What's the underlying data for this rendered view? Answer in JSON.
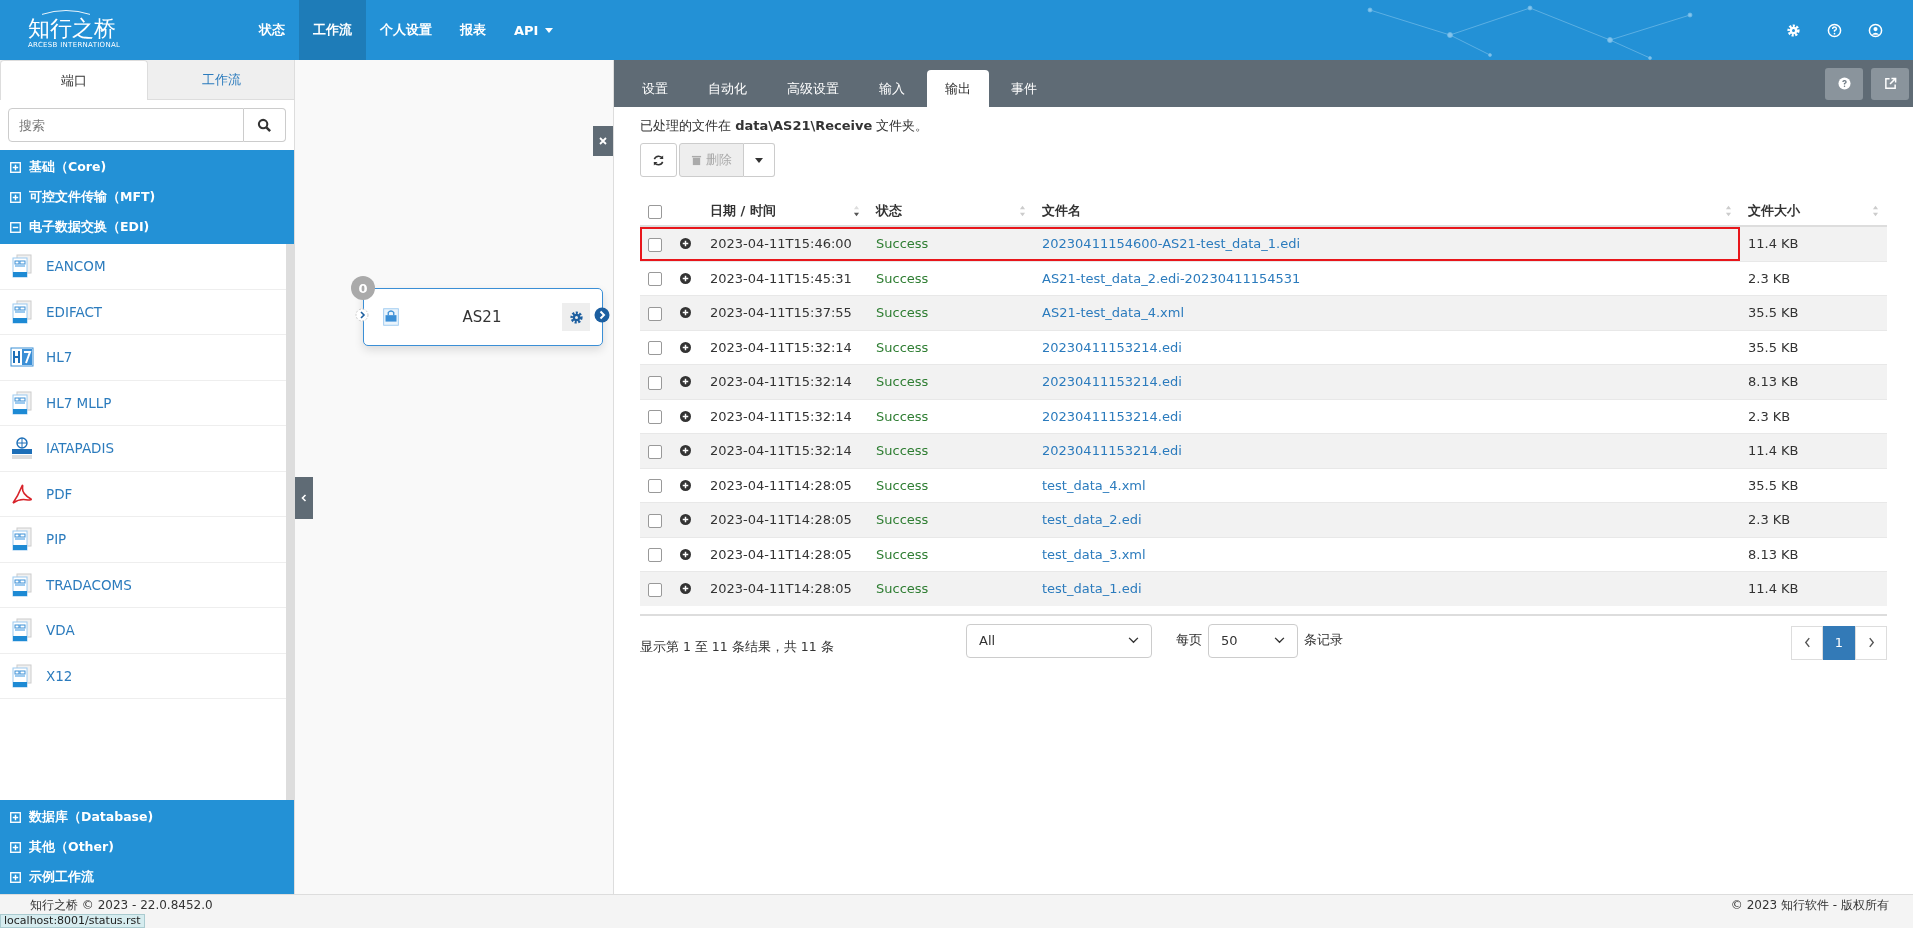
{
  "header": {
    "logo": "知行之桥",
    "logo_sub": "ARCESB INTERNATIONAL",
    "nav": [
      {
        "label": "状态",
        "selected": false,
        "dropdown": false
      },
      {
        "label": "工作流",
        "selected": true,
        "dropdown": false
      },
      {
        "label": "个人设置",
        "selected": false,
        "dropdown": false
      },
      {
        "label": "报表",
        "selected": false,
        "dropdown": false
      },
      {
        "label": "API",
        "selected": false,
        "dropdown": true
      }
    ]
  },
  "sidebar": {
    "tabs": [
      {
        "label": "端口",
        "selected": true
      },
      {
        "label": "工作流",
        "selected": false
      }
    ],
    "search": {
      "placeholder": "搜索"
    },
    "groups_top": [
      {
        "label": "基础（Core)",
        "expanded": false
      },
      {
        "label": "可控文件传输（MFT)",
        "expanded": false
      },
      {
        "label": "电子数据交换（EDI)",
        "expanded": true
      }
    ],
    "items": [
      {
        "label": "EANCOM",
        "kind": "doc"
      },
      {
        "label": "EDIFACT",
        "kind": "doc"
      },
      {
        "label": "HL7",
        "kind": "hl7"
      },
      {
        "label": "HL7 MLLP",
        "kind": "doc"
      },
      {
        "label": "IATAPADIS",
        "kind": "globe"
      },
      {
        "label": "PDF",
        "kind": "pdf"
      },
      {
        "label": "PIP",
        "kind": "doc"
      },
      {
        "label": "TRADACOMS",
        "kind": "doc"
      },
      {
        "label": "VDA",
        "kind": "doc"
      },
      {
        "label": "X12",
        "kind": "doc"
      }
    ],
    "groups_bottom": [
      {
        "label": "数据库（Database)",
        "expanded": false
      },
      {
        "label": "其他（Other)",
        "expanded": false
      },
      {
        "label": "示例工作流",
        "expanded": false
      }
    ]
  },
  "canvas": {
    "node": {
      "label": "AS21",
      "badge": "0"
    }
  },
  "panel": {
    "tabs": [
      {
        "label": "设置",
        "selected": false
      },
      {
        "label": "自动化",
        "selected": false
      },
      {
        "label": "高级设置",
        "selected": false
      },
      {
        "label": "输入",
        "selected": false
      },
      {
        "label": "输出",
        "selected": true
      },
      {
        "label": "事件",
        "selected": false
      }
    ],
    "info": "已处理的文件在 **data\\AS21\\Receive** 文件夹。",
    "delete_button": "删除",
    "table": {
      "all_checked": false,
      "columns": [
        {
          "label": "日期 / 时间",
          "sorted": true
        },
        {
          "label": "状态",
          "sorted": false
        },
        {
          "label": "文件名",
          "sorted": false
        },
        {
          "label": "文件大小",
          "sorted": false
        }
      ],
      "rows": [
        {
          "date": "2023-04-11T15:46:00",
          "status": "Success",
          "file": "20230411154600-AS21-test_data_1.edi",
          "size": "11.4 KB",
          "checked": false,
          "highlighted": true
        },
        {
          "date": "2023-04-11T15:45:31",
          "status": "Success",
          "file": "AS21-test_data_2.edi-20230411154531",
          "size": "2.3 KB",
          "checked": false,
          "highlighted": false
        },
        {
          "date": "2023-04-11T15:37:55",
          "status": "Success",
          "file": "AS21-test_data_4.xml",
          "size": "35.5 KB",
          "checked": false,
          "highlighted": false
        },
        {
          "date": "2023-04-11T15:32:14",
          "status": "Success",
          "file": "20230411153214.edi",
          "size": "35.5 KB",
          "checked": false,
          "highlighted": false
        },
        {
          "date": "2023-04-11T15:32:14",
          "status": "Success",
          "file": "20230411153214.edi",
          "size": "8.13 KB",
          "checked": false,
          "highlighted": false
        },
        {
          "date": "2023-04-11T15:32:14",
          "status": "Success",
          "file": "20230411153214.edi",
          "size": "2.3 KB",
          "checked": false,
          "highlighted": false
        },
        {
          "date": "2023-04-11T15:32:14",
          "status": "Success",
          "file": "20230411153214.edi",
          "size": "11.4 KB",
          "checked": false,
          "highlighted": false
        },
        {
          "date": "2023-04-11T14:28:05",
          "status": "Success",
          "file": "test_data_4.xml",
          "size": "35.5 KB",
          "checked": false,
          "highlighted": false
        },
        {
          "date": "2023-04-11T14:28:05",
          "status": "Success",
          "file": "test_data_2.edi",
          "size": "2.3 KB",
          "checked": false,
          "highlighted": false
        },
        {
          "date": "2023-04-11T14:28:05",
          "status": "Success",
          "file": "test_data_3.xml",
          "size": "8.13 KB",
          "checked": false,
          "highlighted": false
        },
        {
          "date": "2023-04-11T14:28:05",
          "status": "Success",
          "file": "test_data_1.edi",
          "size": "11.4 KB",
          "checked": false,
          "highlighted": false
        }
      ]
    },
    "summary": "显示第 1 至 11 条结果，共 11 条",
    "filter": "All",
    "per_page_label": "每页",
    "per_page": "50",
    "records_label": "条记录",
    "pages": [
      {
        "label": "1",
        "selected": true
      }
    ]
  },
  "footer": {
    "version": "知行之桥 © 2023 - 22.0.8452.0",
    "copyright": "© 2023 知行软件 - 版权所有"
  },
  "status_url": "localhost:8001/status.rst"
}
